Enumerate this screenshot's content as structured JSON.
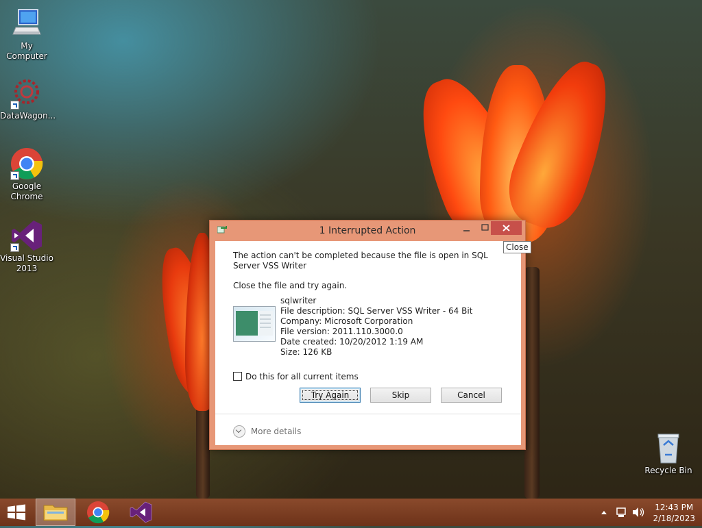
{
  "desktop": {
    "icons": [
      {
        "label": "My Computer",
        "icon": "computer-icon"
      },
      {
        "label": "DataWagon...",
        "icon": "datawagon-icon"
      },
      {
        "label": "Google Chrome",
        "icon": "chrome-icon"
      },
      {
        "label": "Visual Studio 2013",
        "icon": "visual-studio-icon"
      },
      {
        "label": "Recycle Bin",
        "icon": "recycle-bin-icon"
      }
    ]
  },
  "dialog": {
    "title": "1 Interrupted Action",
    "message": "The action can't be completed because the file is open in SQL Server VSS Writer",
    "instruction": "Close the file and try again.",
    "file": {
      "name": "sqlwriter",
      "description": "File description: SQL Server VSS Writer - 64 Bit",
      "company": "Company: Microsoft Corporation",
      "version": "File version: 2011.110.3000.0",
      "created": "Date created: 10/20/2012 1:19 AM",
      "size": "Size: 126 KB"
    },
    "checkbox_label": "Do this for all current items",
    "buttons": {
      "try_again": "Try Again",
      "skip": "Skip",
      "cancel": "Cancel"
    },
    "more_details": "More details",
    "accent_color": "#e79777"
  },
  "tooltip": {
    "close": "Close"
  },
  "taskbar": {
    "items": [
      "start-icon",
      "file-explorer-icon",
      "chrome-icon",
      "visual-studio-icon"
    ],
    "clock": {
      "time": "12:43 PM",
      "date": "2/18/2023"
    }
  }
}
